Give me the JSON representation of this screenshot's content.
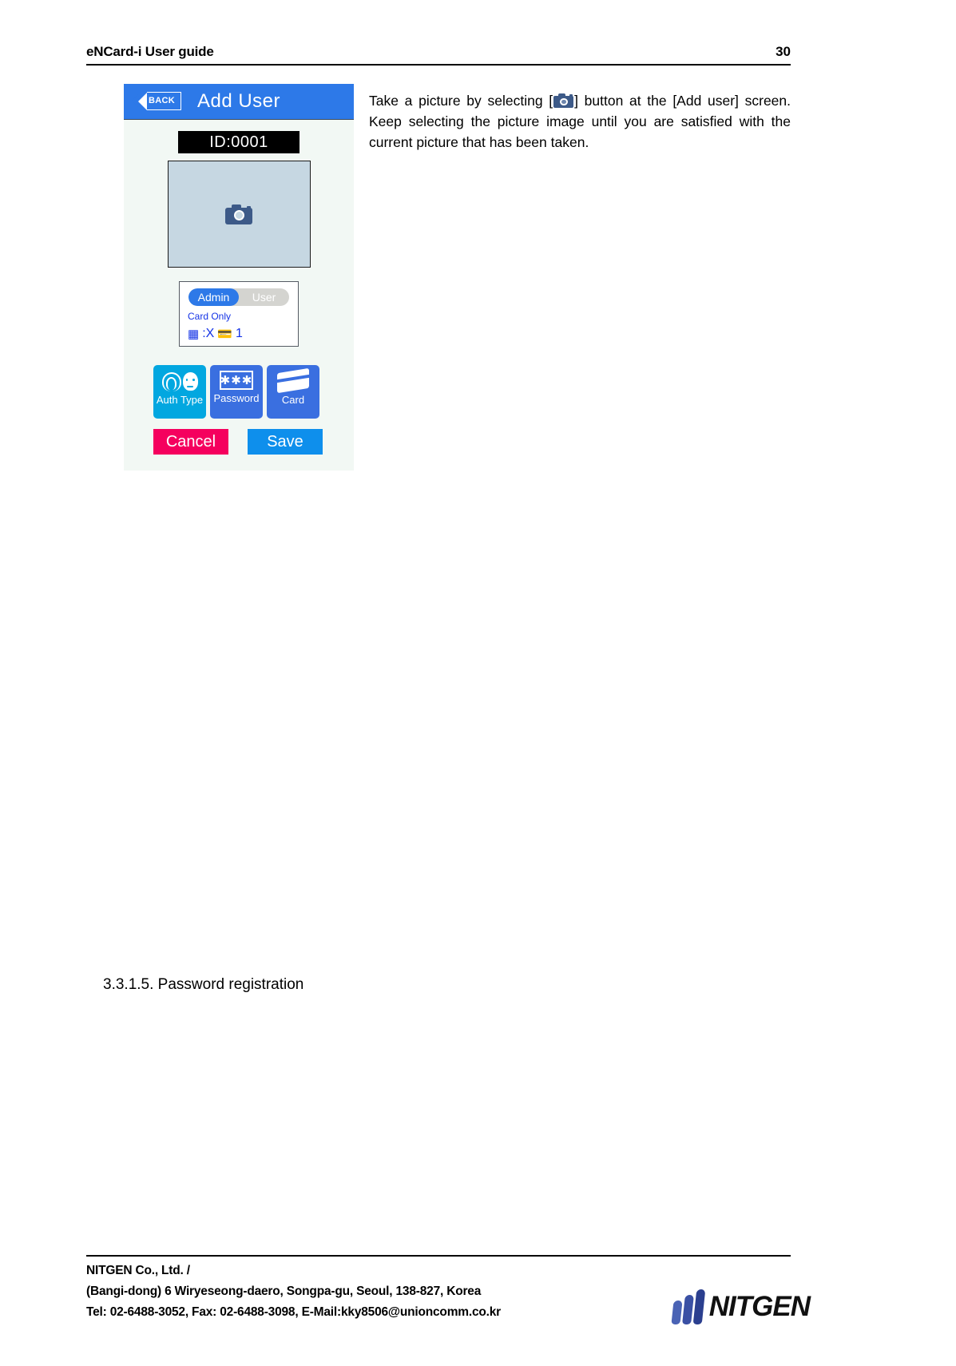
{
  "header": {
    "title": "eNCard-i User guide",
    "page_number": "30"
  },
  "device_screenshot": {
    "topbar": {
      "back_label": "BACK",
      "screen_title": "Add User"
    },
    "id_badge": "ID:0001",
    "photo_placeholder_icon": "camera-icon",
    "info_panel": {
      "segmented_control": {
        "options": [
          "Admin",
          "User"
        ],
        "selected": "Admin"
      },
      "mode_label": "Card Only",
      "counts": {
        "keypad_icon": "keypad-icon",
        "password_count": ":X",
        "card_icon": "card-icon",
        "card_count": "1"
      }
    },
    "auth_buttons": [
      {
        "label": "Auth Type",
        "icon": "fingerprint-face-icon",
        "color": "#02a7e0"
      },
      {
        "label": "Password",
        "icon": "password-asterisks-icon",
        "color": "#3a6fe0"
      },
      {
        "label": "Card",
        "icon": "card-icon",
        "color": "#3a6fe0"
      }
    ],
    "action_buttons": [
      {
        "label": "Cancel",
        "color": "#f5005e"
      },
      {
        "label": "Save",
        "color": "#0e8fec"
      }
    ]
  },
  "body": {
    "paragraph_part1": "Take a picture by selecting [",
    "paragraph_part2": "] button at the [Add user] screen. Keep selecting the picture image until you are satisfied with the current picture that has been taken."
  },
  "section": {
    "heading": "3.3.1.5. Password registration"
  },
  "footer": {
    "line1": "NITGEN Co., Ltd. /",
    "line2": "(Bangi-dong) 6 Wiryeseong-daero, Songpa-gu, Seoul, 138-827, Korea",
    "line3": "Tel: 02-6488-3052, Fax: 02-6488-3098, E-Mail:kky8506@unioncomm.co.kr",
    "logo_text": "NITGEN"
  }
}
